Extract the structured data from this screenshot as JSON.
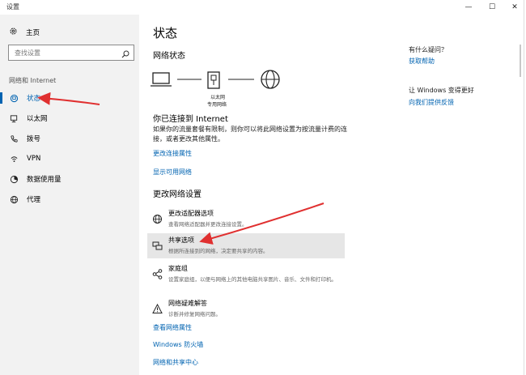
{
  "window": {
    "title": "设置",
    "minimize_glyph": "—",
    "maximize_glyph": "☐",
    "close_glyph": "✕"
  },
  "sidebar": {
    "home_label": "主页",
    "search_placeholder": "查找设置",
    "section_label": "网络和 Internet",
    "items": [
      {
        "label": "状态",
        "icon": "globe-status-icon",
        "active": true
      },
      {
        "label": "以太网",
        "icon": "ethernet-icon",
        "active": false
      },
      {
        "label": "拨号",
        "icon": "dialup-icon",
        "active": false
      },
      {
        "label": "VPN",
        "icon": "vpn-icon",
        "active": false
      },
      {
        "label": "数据使用量",
        "icon": "data-usage-icon",
        "active": false
      },
      {
        "label": "代理",
        "icon": "proxy-globe-icon",
        "active": false
      }
    ]
  },
  "main": {
    "page_title": "状态",
    "network_status_heading": "网络状态",
    "ethernet_label": "以太网",
    "network_type": "专用网络",
    "connected_heading": "你已连接到 Internet",
    "connected_desc": "如果你的流量套餐有限制，则你可以将此网络设置为按流量计费的连接，或者更改其他属性。",
    "link_change_props": "更改连接属性",
    "link_show_networks": "显示可用网络",
    "change_settings_heading": "更改网络设置",
    "options": [
      {
        "title": "更改适配器选项",
        "desc": "查看网络适配器并更改连接设置。",
        "icon": "adapter-globe-icon"
      },
      {
        "title": "共享选项",
        "desc": "根据所连接到的网络，决定要共享的内容。",
        "icon": "sharing-icon"
      },
      {
        "title": "家庭组",
        "desc": "设置家庭组，以便与网络上的其他电脑共享图片、音乐、文件和打印机。",
        "icon": "homegroup-icon"
      },
      {
        "title": "网络疑难解答",
        "desc": "诊断并修复网络问题。",
        "icon": "warning-icon"
      }
    ],
    "link_view_properties": "查看网络属性",
    "link_firewall": "Windows 防火墙",
    "link_sharing_center": "网络和共享中心"
  },
  "right_panel": {
    "question_heading": "有什么疑问？",
    "get_help_link": "获取帮助",
    "improve_heading": "让 Windows 变得更好",
    "feedback_link": "向我们提供反馈"
  },
  "colors": {
    "accent": "#0063b1",
    "annotation_arrow": "#e03030",
    "sidebar_bg": "#f2f2f2"
  }
}
